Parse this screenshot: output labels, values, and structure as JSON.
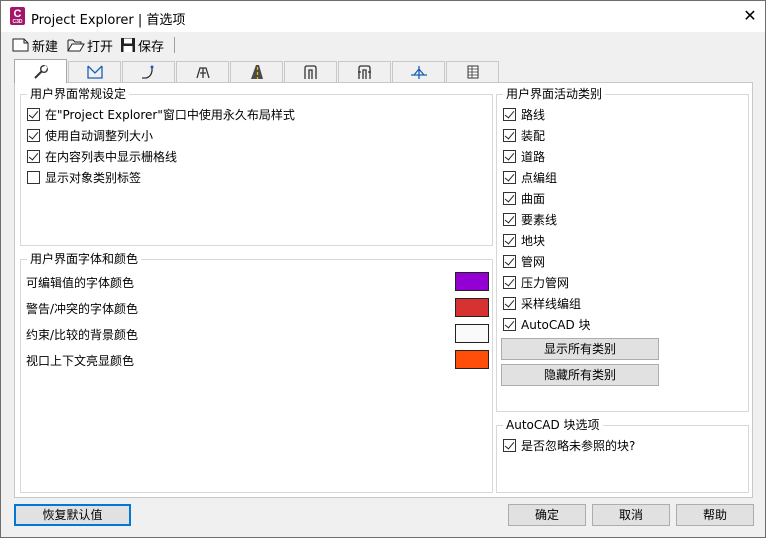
{
  "window": {
    "title": "Project Explorer | 首选项",
    "app_icon_letter": "C",
    "app_icon_sub": "C3D",
    "close_glyph": "✕"
  },
  "toolbar": {
    "new_label": "新建",
    "open_label": "打开",
    "save_label": "保存"
  },
  "tabs": [
    {
      "icon": "wrench-icon"
    },
    {
      "icon": "surface-icon"
    },
    {
      "icon": "alignment-icon"
    },
    {
      "icon": "survey-icon"
    },
    {
      "icon": "road-icon"
    },
    {
      "icon": "pipe-network-icon"
    },
    {
      "icon": "pressure-network-icon"
    },
    {
      "icon": "profile-icon"
    },
    {
      "icon": "table-icon"
    }
  ],
  "general": {
    "title": "用户界面常规设定",
    "options": [
      {
        "label": "在\"Project Explorer\"窗口中使用永久布局样式",
        "checked": true
      },
      {
        "label": "使用自动调整列大小",
        "checked": true
      },
      {
        "label": "在内容列表中显示栅格线",
        "checked": true
      },
      {
        "label": "显示对象类别标签",
        "checked": false
      }
    ]
  },
  "fonts": {
    "title": "用户界面字体和颜色",
    "rows": [
      {
        "label": "可编辑值的字体颜色",
        "color": "#9400d3"
      },
      {
        "label": "警告/冲突的字体颜色",
        "color": "#d63232"
      },
      {
        "label": "约束/比较的背景颜色",
        "color": "#fafafa"
      },
      {
        "label": "视口上下文亮显颜色",
        "color": "#ff4e0a"
      }
    ]
  },
  "categories": {
    "title": "用户界面活动类别",
    "items": [
      {
        "label": "路线",
        "checked": true
      },
      {
        "label": "装配",
        "checked": true
      },
      {
        "label": "道路",
        "checked": true
      },
      {
        "label": "点编组",
        "checked": true
      },
      {
        "label": "曲面",
        "checked": true
      },
      {
        "label": "要素线",
        "checked": true
      },
      {
        "label": "地块",
        "checked": true
      },
      {
        "label": "管网",
        "checked": true
      },
      {
        "label": "压力管网",
        "checked": true
      },
      {
        "label": "采样线编组",
        "checked": true
      },
      {
        "label": "AutoCAD 块",
        "checked": true
      }
    ],
    "show_all_label": "显示所有类别",
    "hide_all_label": "隐藏所有类别"
  },
  "block_options": {
    "title": "AutoCAD 块选项",
    "ignore_unreferenced_label": "是否忽略未参照的块?",
    "ignore_unreferenced_checked": true
  },
  "footer": {
    "restore_label": "恢复默认值",
    "ok_label": "确定",
    "cancel_label": "取消",
    "help_label": "帮助"
  }
}
